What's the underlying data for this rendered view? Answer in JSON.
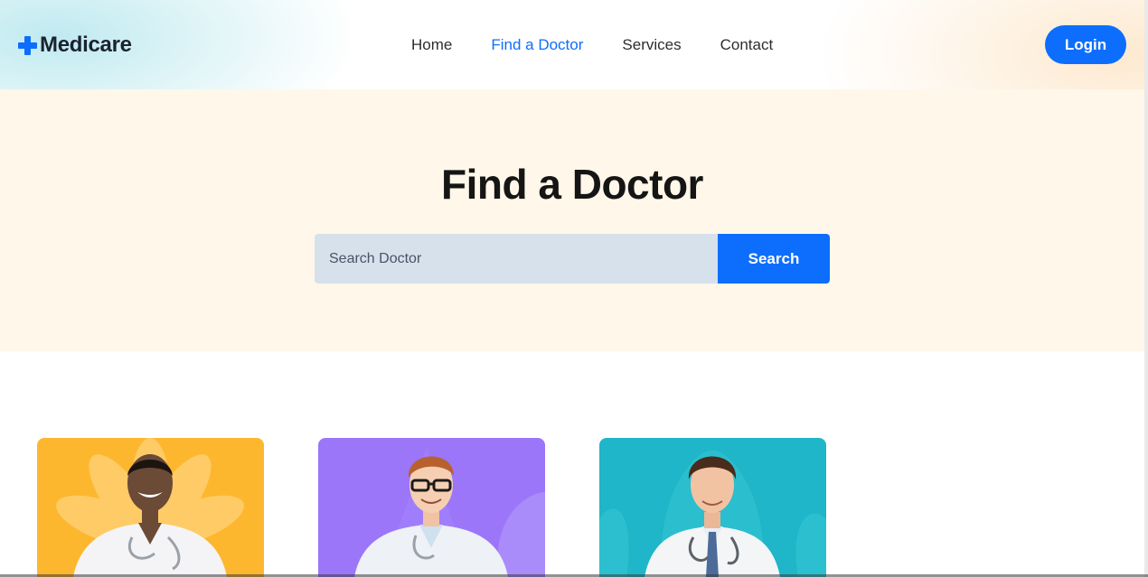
{
  "header": {
    "logo_text": "Medicare",
    "nav": [
      {
        "label": "Home",
        "active": false
      },
      {
        "label": "Find a Doctor",
        "active": true
      },
      {
        "label": "Services",
        "active": false
      },
      {
        "label": "Contact",
        "active": false
      }
    ],
    "login_label": "Login"
  },
  "hero": {
    "title": "Find a Doctor",
    "search": {
      "placeholder": "Search Doctor",
      "value": "",
      "button_label": "Search"
    }
  },
  "doctors": [
    {
      "card_color": "#fdb72f",
      "image": "doctor-photo"
    },
    {
      "card_color": "#9b76f9",
      "image": "doctor-photo"
    },
    {
      "card_color": "#1eb6c8",
      "image": "doctor-photo"
    }
  ],
  "colors": {
    "accent": "#0d6efd",
    "hero_background": "#fff7e9",
    "search_field": "#d7e1ec"
  }
}
